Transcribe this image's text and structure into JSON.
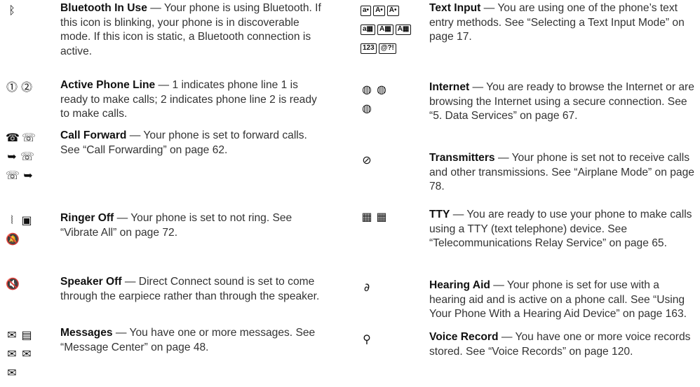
{
  "left_column": [
    {
      "key": "bluetooth",
      "title": "Bluetooth In Use",
      "body": " — Your phone is using Bluetooth. If this icon is blinking, your phone is in discoverable mode. If this icon is static, a Bluetooth connection is active.",
      "icons": [
        [
          "bluetooth-icon"
        ]
      ]
    },
    {
      "key": "active-phone-line",
      "title": "Active Phone Line",
      "body": " — 1 indicates phone line 1 is ready to make calls; 2 indicates phone line 2 is ready to make calls.",
      "icons": [
        [
          "phone-line-1-icon",
          "phone-line-2-icon"
        ]
      ]
    },
    {
      "key": "call-forward",
      "title": "Call Forward",
      "body": " — Your phone is set to forward calls. See “Call Forwarding” on page 62.",
      "icons": [
        [
          "call-forward-line1-icon",
          "call-forward-line2-icon"
        ],
        [
          "call-forward-both-icon",
          "call-forward-both-alt-icon"
        ],
        [
          "call-forward-line2-alt-icon",
          "call-forward-line1-alt-icon"
        ]
      ]
    },
    {
      "key": "ringer-off",
      "title": "Ringer Off",
      "body": " — Your phone is set to not ring. See “Vibrate All” on page 72.",
      "icons": [
        [
          "vibrate-icon",
          "vibrate-framed-icon"
        ],
        [
          "bell-off-icon"
        ]
      ]
    },
    {
      "key": "speaker-off",
      "title": "Speaker Off",
      "body": " — Direct Connect sound is set to come through the earpiece rather than through the speaker.",
      "icons": [
        [
          "speaker-off-icon"
        ]
      ]
    },
    {
      "key": "messages",
      "title": "Messages",
      "body": " — You have one or more messages. See “Message Center” on page 48.",
      "icons": [
        [
          "envelope-icon",
          "envelope-voicemail-icon"
        ],
        [
          "envelope-email-icon",
          "envelope-filled-icon"
        ],
        [
          "envelope-check-icon"
        ]
      ]
    }
  ],
  "right_column": [
    {
      "key": "text-input",
      "title": "Text Input",
      "body": " — You are using one of the phone’s text entry methods. See “Selecting a Text Input Mode” on page 17.",
      "icons": [
        [
          "text-mode-abc-icon",
          "text-mode-Abc-icon",
          "text-mode-ABC-icon"
        ],
        [
          "text-mode-word-abc-icon",
          "text-mode-word-Abc-icon",
          "text-mode-word-ABC-icon"
        ],
        [
          "text-mode-numeric-icon",
          "text-mode-symbols-icon"
        ]
      ],
      "labels": {
        "text-mode-abc-icon": "a•",
        "text-mode-Abc-icon": "A•",
        "text-mode-ABC-icon": "A•",
        "text-mode-word-abc-icon": "a▦",
        "text-mode-word-Abc-icon": "A▦",
        "text-mode-word-ABC-icon": "A▦",
        "text-mode-numeric-icon": "123",
        "text-mode-symbols-icon": "@?!"
      }
    },
    {
      "key": "internet",
      "title": "Internet",
      "body": " — You are ready to browse the Internet or are browsing the Internet using a secure connection. See “5. Data Services” on page 67.",
      "icons": [
        [
          "globe-icon",
          "globe-secure-icon"
        ],
        [
          "globe-secure-alt-icon"
        ]
      ]
    },
    {
      "key": "transmitters",
      "title": "Transmitters",
      "body": " — Your phone is set not to receive calls and other transmissions. See “Airplane Mode” on page 78.",
      "icons": [
        [
          "transmitters-off-icon"
        ]
      ]
    },
    {
      "key": "tty",
      "title": "TTY",
      "body": " — You are ready to use your phone to make calls using a TTY (text telephone) device. See “Telecommunications Relay Service” on page 65.",
      "icons": [
        [
          "tty-icon",
          "tty-active-icon"
        ]
      ]
    },
    {
      "key": "hearing-aid",
      "title": "Hearing Aid",
      "body": " — Your phone is set for use with a hearing aid and is active on a phone call. See “Using Your Phone With a Hearing Aid Device” on page 163.",
      "icons": [
        [
          "hearing-aid-icon"
        ]
      ]
    },
    {
      "key": "voice-record",
      "title": "Voice Record",
      "body": " — You have one or more voice records stored. See “Voice Records” on page 120.",
      "icons": [
        [
          "voice-record-icon"
        ]
      ]
    }
  ]
}
